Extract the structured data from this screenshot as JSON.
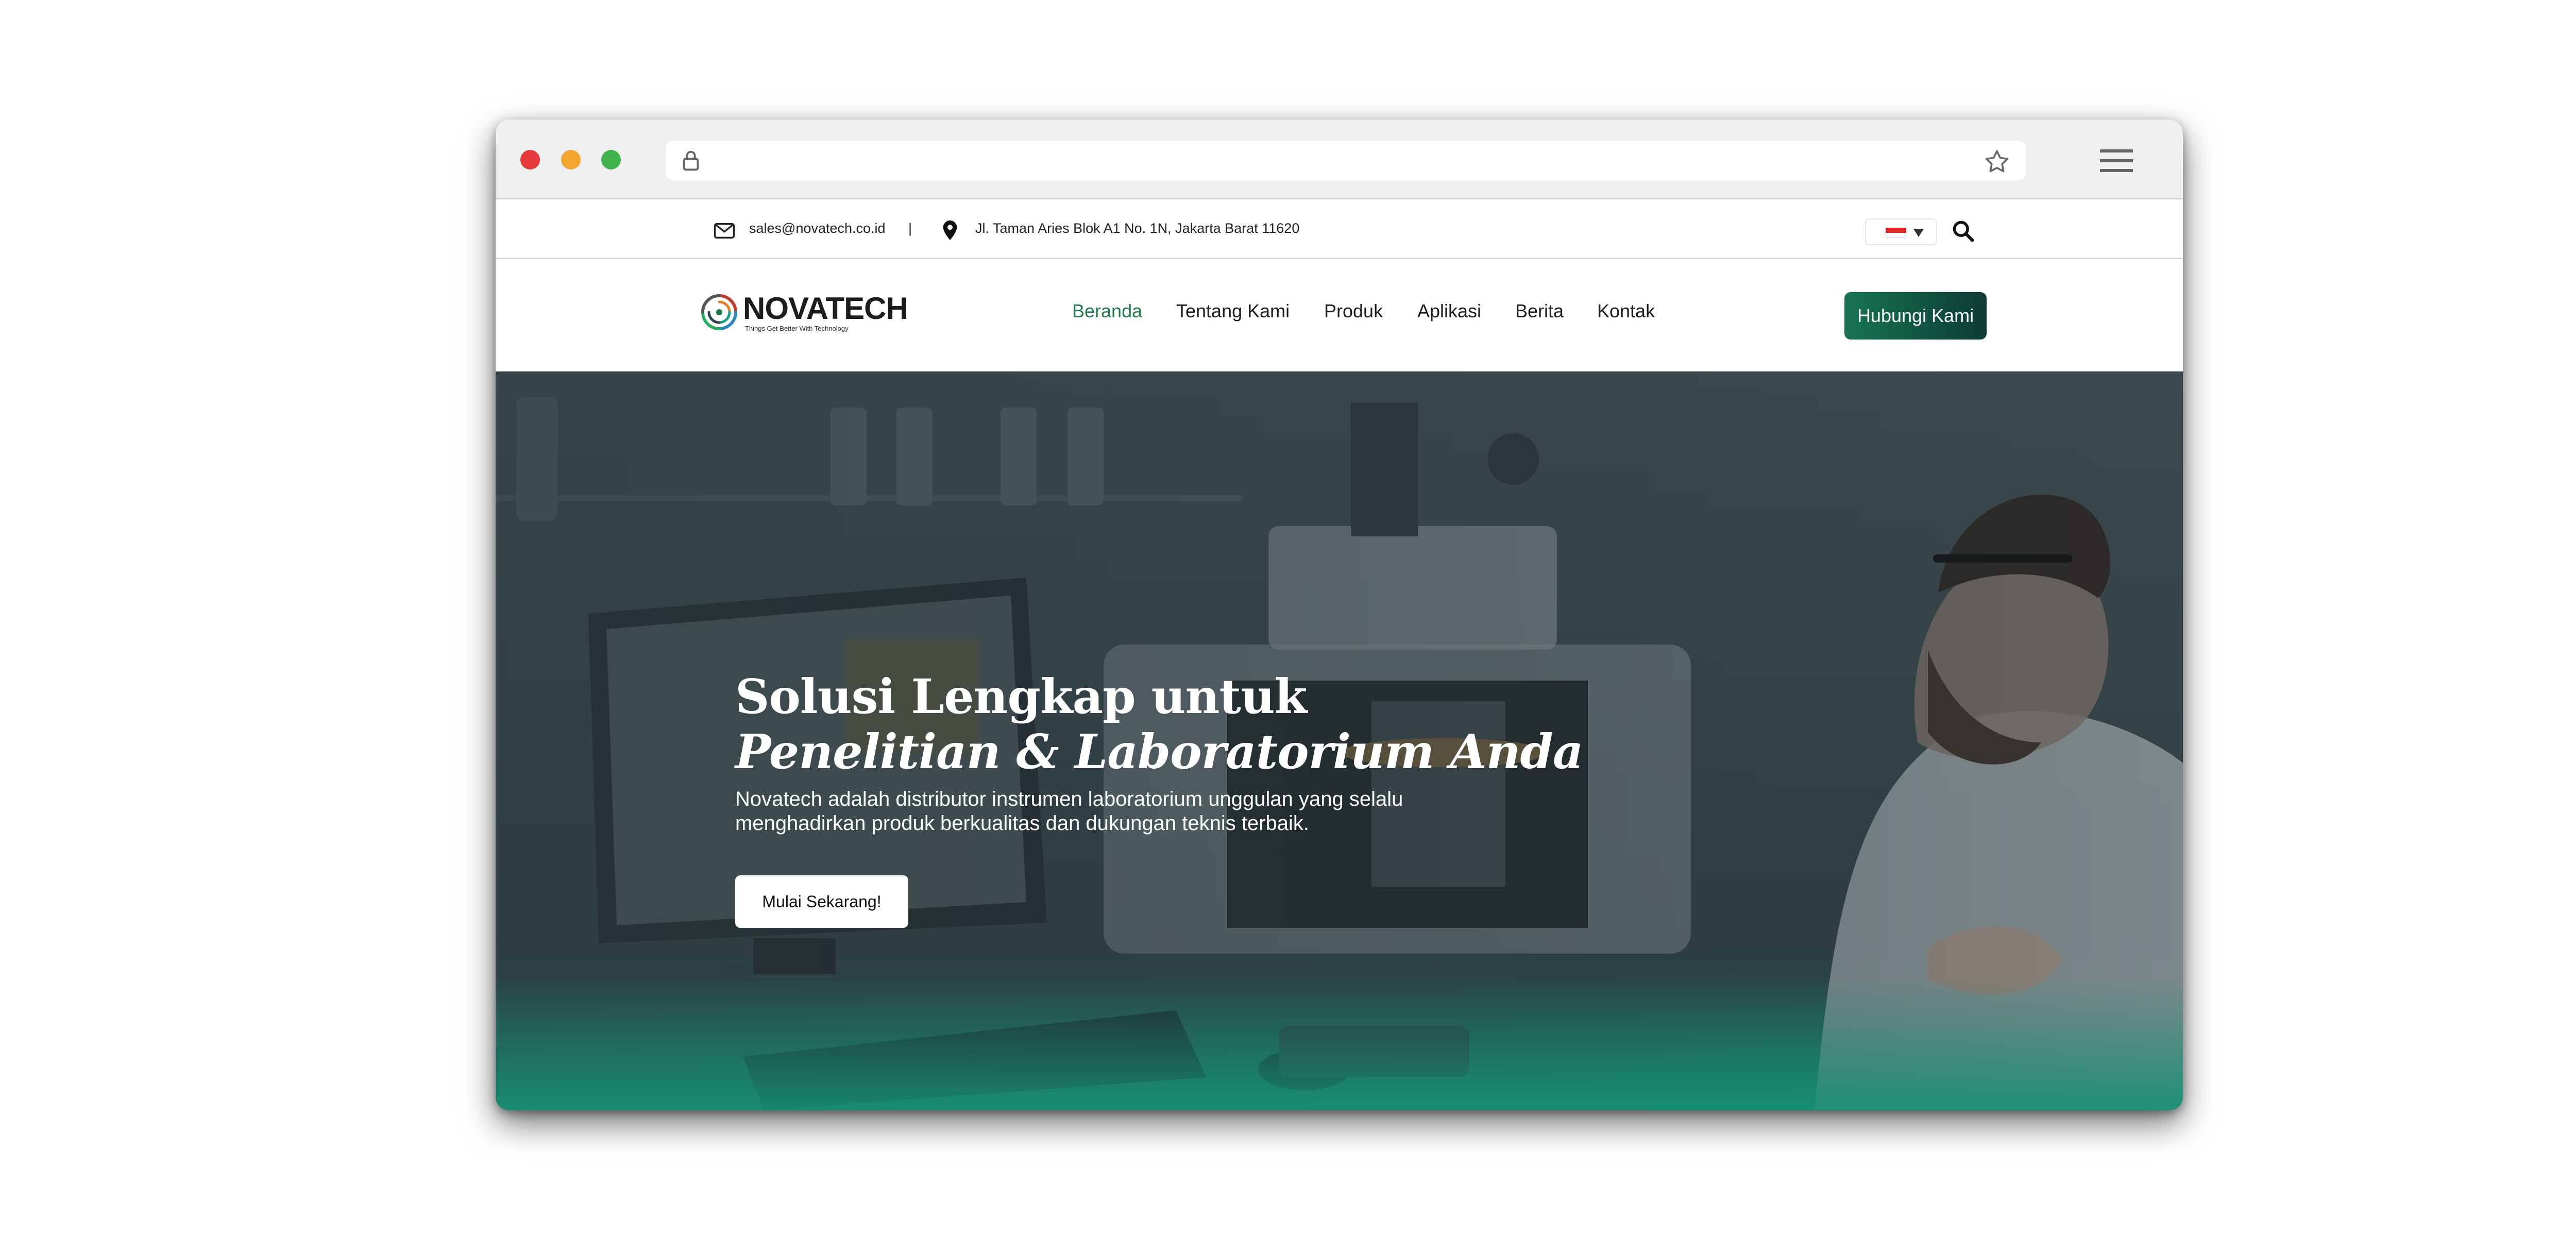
{
  "colors": {
    "brand_green": "#1f7a4a",
    "cta_gradient_start": "#167552",
    "cta_gradient_end": "#0d3b34",
    "hero_overlay": "#36454a"
  },
  "browser": {
    "icons": [
      "lock-icon",
      "star-icon",
      "hamburger-menu-icon"
    ]
  },
  "topbar": {
    "email": "sales@novatech.co.id",
    "separator": "|",
    "address": "Jl. Taman Aries Blok A1 No. 1N, Jakarta Barat 11620",
    "language_flag": "Indonesia",
    "icons": [
      "mail-icon",
      "location-pin-icon",
      "chevron-down-icon",
      "search-icon"
    ]
  },
  "navbar": {
    "logo_text": "NOVATECH",
    "logo_tagline": "Things Get Better With Technology",
    "links": [
      {
        "label": "Beranda",
        "active": true
      },
      {
        "label": "Tentang Kami",
        "active": false
      },
      {
        "label": "Produk",
        "active": false
      },
      {
        "label": "Aplikasi",
        "active": false
      },
      {
        "label": "Berita",
        "active": false
      },
      {
        "label": "Kontak",
        "active": false
      }
    ],
    "cta_label": "Hubungi Kami"
  },
  "hero": {
    "title_line1": "Solusi Lengkap untuk",
    "title_line2": "Penelitian & Laboratorium Anda",
    "description_line1": "Novatech adalah distributor instrumen laboratorium unggulan yang selalu",
    "description_line2": "menghadirkan produk berkualitas dan dukungan teknis terbaik.",
    "button_label": "Mulai Sekarang!"
  }
}
